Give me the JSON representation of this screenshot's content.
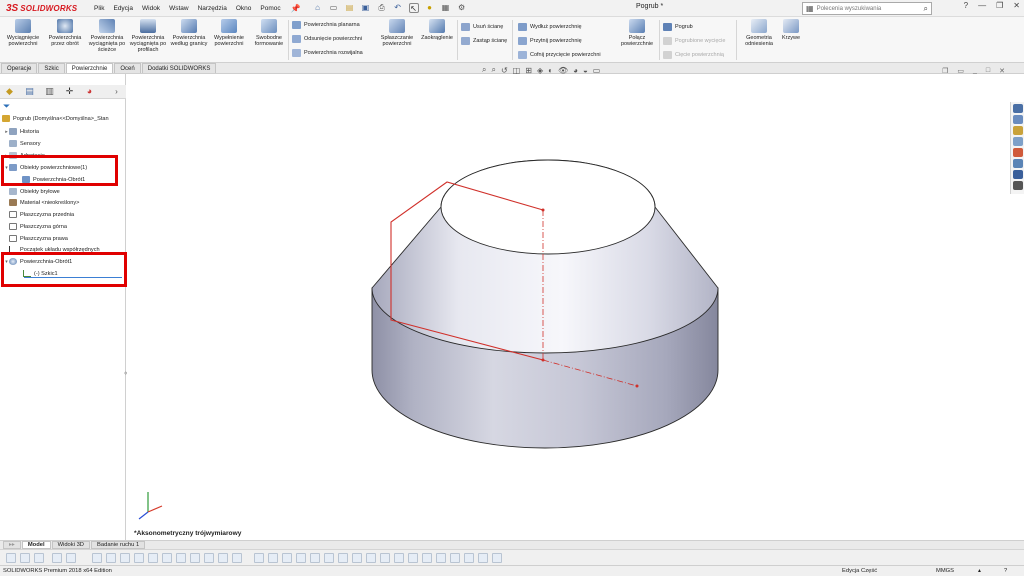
{
  "app": {
    "brand": "SOLIDWORKS",
    "brand_mark": "3S",
    "document_title": "Pogrub *"
  },
  "menu": [
    "Plik",
    "Edycja",
    "Widok",
    "Wstaw",
    "Narzędzia",
    "Okno",
    "Pomoc"
  ],
  "search": {
    "placeholder": "Polecenia wyszukiwania"
  },
  "ribbon": {
    "large_buttons": [
      "Wyciągnięcie powierzchni",
      "Powierzchnia przez obrót",
      "Powierzchnia wyciągnięta po ścieżce",
      "Powierzchnia wyciągnięta po profilach",
      "Powierzchnia według granicy",
      "Wypełnienie powierzchni",
      "Swobodne formowanie"
    ],
    "group1_small": [
      "Powierzchnia planarna",
      "Odsunięcie powierzchni",
      "Powierzchnia rozwijalna"
    ],
    "splaszczanie": "Spłaszczanie powierzchni",
    "zaokraglenie": "Zaokrąglenie",
    "group2_small": [
      "Usuń ścianę",
      "Zastąp ścianę"
    ],
    "group3_small": [
      "Wydłuż powierzchnię",
      "Przytnij powierzchnię",
      "Cofnij przycięcie powierzchni"
    ],
    "polacz": "Połącz powierzchnie",
    "group4_small": [
      "Pogrub",
      "Pogrubione wycięcie",
      "Cięcie powierzchnią"
    ],
    "geometria": "Geometria odniesienia",
    "krzywe": "Krzywe"
  },
  "command_tabs": [
    "Operacje",
    "Szkic",
    "Powierzchnie",
    "Oceń",
    "Dodatki SOLIDWORKS"
  ],
  "command_tabs_active": "Powierzchnie",
  "tree": {
    "root": "Pogrub  (Domyślna<<Domyślna>_Stan",
    "items": [
      "Historia",
      "Sensory",
      "Adnotacje",
      "Obiekty powierzchniowe(1)",
      "Powierzchnia-Obrót1",
      "Obiekty bryłowe",
      "Materiał <nieokreślony>",
      "Płaszczyzna przednia",
      "Płaszczyzna górna",
      "Płaszczyzna prawa",
      "Początek układu współrzędnych",
      "Powierzchnia-Obrót1",
      "(-) Szkic1"
    ]
  },
  "viewport": {
    "view_label": "*Aksonometryczny trójwymiarowy"
  },
  "bottom_tabs": [
    "Model",
    "Widoki 3D",
    "Badanie ruchu 1"
  ],
  "bottom_tabs_active": "Model",
  "status": {
    "edition": "SOLIDWORKS Premium 2018 x64 Edition",
    "mode": "Edycja Część",
    "units": "MMGS"
  },
  "colors": {
    "accent": "#d71920",
    "highlight": "#e00000",
    "sketch_red": "#d0302a",
    "selection_blue": "#3b7fd4"
  }
}
